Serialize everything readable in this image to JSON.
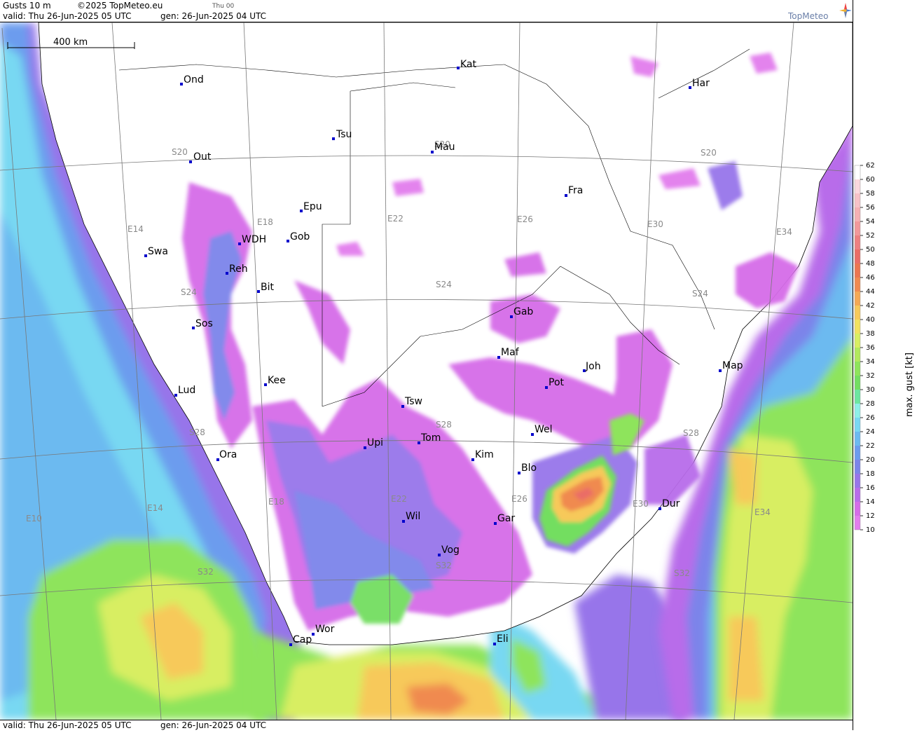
{
  "header": {
    "title": "Gusts 10 m",
    "copyright": "©2025 TopMeteo.eu",
    "run_label": "Thu 00",
    "valid": "valid:  Thu  26-Jun-2025  05 UTC",
    "gen": "gen: 26-Jun-2025 04 UTC",
    "brand": "TopMeteo"
  },
  "footer": {
    "valid": "valid:  Thu  26-Jun-2025  05 UTC",
    "gen": "gen: 26-Jun-2025 04 UTC"
  },
  "scale_bar": {
    "label": "400 km"
  },
  "legend": {
    "title": "max. gust [kt]",
    "ticks": [
      62,
      60,
      58,
      56,
      54,
      52,
      50,
      48,
      46,
      44,
      42,
      40,
      38,
      36,
      34,
      32,
      30,
      28,
      26,
      24,
      22,
      20,
      18,
      16,
      14,
      12,
      10
    ],
    "colors": {
      "62": "#ffffff",
      "60": "#fbd8dd",
      "58": "#f7c2c7",
      "56": "#f5b0b3",
      "54": "#f2989a",
      "52": "#ee8080",
      "50": "#ea6d66",
      "48": "#ec7650",
      "46": "#f08a4f",
      "44": "#f5a954",
      "42": "#f7c95a",
      "40": "#f2e25e",
      "38": "#d8ee62",
      "36": "#b2e95c",
      "34": "#8ee45b",
      "32": "#73de61",
      "30": "#6ce6a0",
      "28": "#8df0e8",
      "26": "#78d8f2",
      "24": "#6cbaf0",
      "22": "#6c9cee",
      "20": "#7b84ea",
      "18": "#9775ea",
      "16": "#b86cea",
      "14": "#d56ce8",
      "12": "#e27ded"
    }
  },
  "grid_labels": {
    "lat": [
      "S20",
      "S20",
      "S20",
      "S24",
      "S24",
      "S24",
      "S28",
      "S28",
      "S28",
      "S32",
      "S32",
      "S32"
    ],
    "lon": [
      "E10",
      "E14",
      "E14",
      "E18",
      "E18",
      "E22",
      "E22",
      "E26",
      "E26",
      "E30",
      "E30",
      "E34",
      "E34"
    ]
  },
  "cities": [
    {
      "name": "Kat"
    },
    {
      "name": "Ond"
    },
    {
      "name": "Har"
    },
    {
      "name": "Tsu"
    },
    {
      "name": "Mau"
    },
    {
      "name": "Out"
    },
    {
      "name": "Fra"
    },
    {
      "name": "Epu"
    },
    {
      "name": "Gob"
    },
    {
      "name": "WDH"
    },
    {
      "name": "Swa"
    },
    {
      "name": "Reh"
    },
    {
      "name": "Bit"
    },
    {
      "name": "Gab"
    },
    {
      "name": "Sos"
    },
    {
      "name": "Maf"
    },
    {
      "name": "Joh"
    },
    {
      "name": "Map"
    },
    {
      "name": "Kee"
    },
    {
      "name": "Lud"
    },
    {
      "name": "Pot"
    },
    {
      "name": "Tsw"
    },
    {
      "name": "Wel"
    },
    {
      "name": "Upi"
    },
    {
      "name": "Tom"
    },
    {
      "name": "Kim"
    },
    {
      "name": "Ora"
    },
    {
      "name": "Blo"
    },
    {
      "name": "Dur"
    },
    {
      "name": "Wil"
    },
    {
      "name": "Gar"
    },
    {
      "name": "Vog"
    },
    {
      "name": "Wor"
    },
    {
      "name": "Cap"
    },
    {
      "name": "Eli"
    }
  ]
}
